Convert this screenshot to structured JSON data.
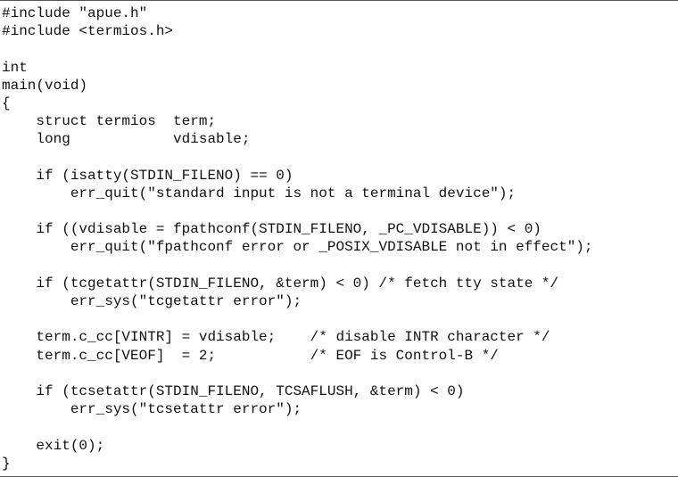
{
  "code": {
    "lines": [
      "#include \"apue.h\"",
      "#include <termios.h>",
      "",
      "int",
      "main(void)",
      "{",
      "    struct termios  term;",
      "    long            vdisable;",
      "",
      "    if (isatty(STDIN_FILENO) == 0)",
      "        err_quit(\"standard input is not a terminal device\");",
      "",
      "    if ((vdisable = fpathconf(STDIN_FILENO, _PC_VDISABLE)) < 0)",
      "        err_quit(\"fpathconf error or _POSIX_VDISABLE not in effect\");",
      "",
      "    if (tcgetattr(STDIN_FILENO, &term) < 0) /* fetch tty state */",
      "        err_sys(\"tcgetattr error\");",
      "",
      "    term.c_cc[VINTR] = vdisable;    /* disable INTR character */",
      "    term.c_cc[VEOF]  = 2;           /* EOF is Control-B */",
      "",
      "    if (tcsetattr(STDIN_FILENO, TCSAFLUSH, &term) < 0)",
      "        err_sys(\"tcsetattr error\");",
      "",
      "    exit(0);",
      "}"
    ]
  }
}
